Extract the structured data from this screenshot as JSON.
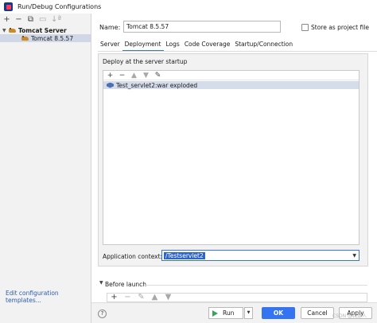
{
  "window": {
    "title": "Run/Debug Configurations"
  },
  "sidebar": {
    "toolbar": {
      "add": "+",
      "remove": "−",
      "copy": "⧉",
      "folder": "▭",
      "sort": "↓ª"
    },
    "server_group": "Tomcat Server",
    "config_item": "Tomcat 8.5.57",
    "edit_templates": "Edit configuration templates..."
  },
  "form": {
    "name_label": "Name:",
    "name_value": "Tomcat 8.5.57",
    "store_label": "Store as project file",
    "store_checked": false
  },
  "tabs": [
    {
      "label": "Server",
      "active": false
    },
    {
      "label": "Deployment",
      "active": true
    },
    {
      "label": "Logs",
      "active": false
    },
    {
      "label": "Code Coverage",
      "active": false
    },
    {
      "label": "Startup/Connection",
      "active": false
    }
  ],
  "deployment": {
    "section_title": "Deploy at the server startup",
    "toolbar": {
      "add": "+",
      "remove": "−",
      "up": "▲",
      "down": "▼",
      "edit": "✎"
    },
    "artifacts": [
      "Test_servlet2:war exploded"
    ],
    "context_label": "Application context:",
    "context_value": "/Testservlet2"
  },
  "before_launch": {
    "label": "Before launch",
    "toolbar": {
      "add": "+",
      "remove": "−",
      "edit": "✎",
      "up": "▲",
      "down": "▼"
    }
  },
  "buttons": {
    "help": "?",
    "run": "Run",
    "ok": "OK",
    "cancel": "Cancel",
    "apply": "Apply"
  },
  "watermark": "CSDN @我是人",
  "colors": {
    "accent": "#3574f0",
    "selection": "#d5dcea",
    "run_green": "#3aa35a"
  }
}
